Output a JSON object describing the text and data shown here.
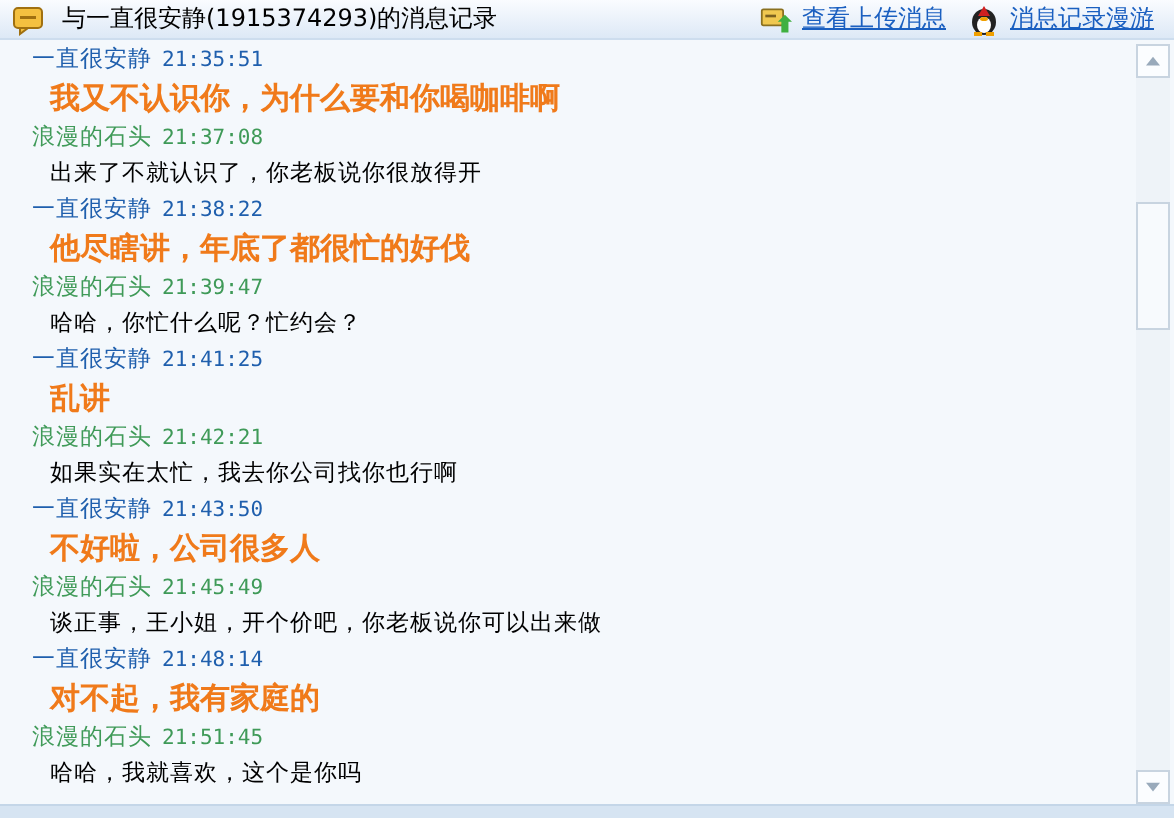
{
  "header": {
    "title": "与一直很安静(1915374293)的消息记录",
    "links": [
      "查看上传消息",
      "消息记录漫游"
    ]
  },
  "messages": [
    {
      "kind": "contact",
      "sender": "一直很安静",
      "time": "21:35:51",
      "text": "我又不认识你，为什么要和你喝咖啡啊"
    },
    {
      "kind": "self",
      "sender": "浪漫的石头",
      "time": "21:37:08",
      "text": "出来了不就认识了，你老板说你很放得开"
    },
    {
      "kind": "contact",
      "sender": "一直很安静",
      "time": "21:38:22",
      "text": "他尽瞎讲，年底了都很忙的好伐"
    },
    {
      "kind": "self",
      "sender": "浪漫的石头",
      "time": "21:39:47",
      "text": "哈哈，你忙什么呢？忙约会？"
    },
    {
      "kind": "contact",
      "sender": "一直很安静",
      "time": "21:41:25",
      "text": "乱讲"
    },
    {
      "kind": "self",
      "sender": "浪漫的石头",
      "time": "21:42:21",
      "text": "如果实在太忙，我去你公司找你也行啊"
    },
    {
      "kind": "contact",
      "sender": "一直很安静",
      "time": "21:43:50",
      "text": "不好啦，公司很多人"
    },
    {
      "kind": "self",
      "sender": "浪漫的石头",
      "time": "21:45:49",
      "text": "谈正事，王小姐，开个价吧，你老板说你可以出来做"
    },
    {
      "kind": "contact",
      "sender": "一直很安静",
      "time": "21:48:14",
      "text": "对不起，我有家庭的"
    },
    {
      "kind": "self",
      "sender": "浪漫的石头",
      "time": "21:51:45",
      "text": "哈哈，我就喜欢，这个是你吗"
    }
  ]
}
